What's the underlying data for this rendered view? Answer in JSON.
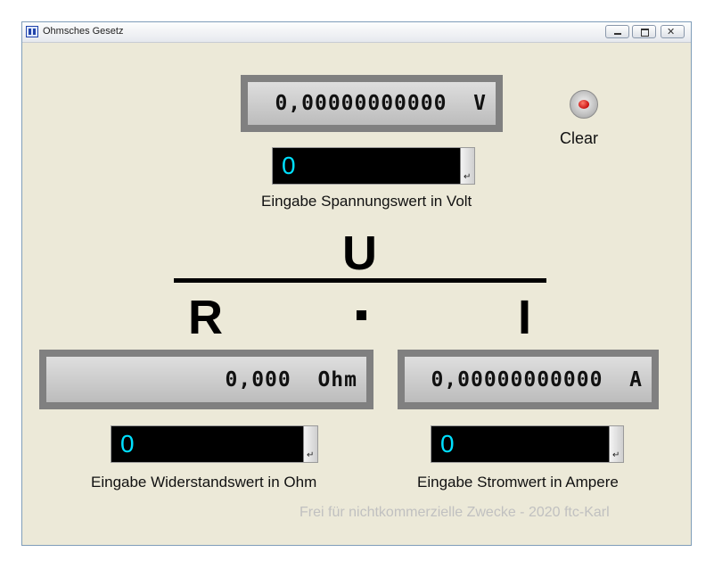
{
  "window": {
    "title": "Ohmsches Gesetz",
    "minimize_glyph": "",
    "close_glyph": "✕"
  },
  "voltage": {
    "display": "0,00000000000  V",
    "input_value": "0",
    "label": "Eingabe Spannungswert in Volt"
  },
  "resistance": {
    "display": "0,000  Ohm",
    "input_value": "0",
    "label": "Eingabe Widerstandswert in Ohm"
  },
  "current": {
    "display": "0,00000000000  A",
    "input_value": "0",
    "label": "Eingabe Stromwert in Ampere"
  },
  "enter_glyph": "↵",
  "clear": {
    "label": "Clear",
    "led_color": "#d01010"
  },
  "formula": {
    "numerator": "U",
    "left": "R",
    "right": "I"
  },
  "footer": "Frei für nichtkommerzielle Zwecke - 2020 ftc-Karl",
  "colors": {
    "background": "#ece9d8",
    "input_text": "#00e0ff",
    "display_frame": "#808080"
  },
  "icons": {
    "app": "app-icon",
    "minimize": "minimize-icon",
    "maximize": "maximize-icon",
    "close": "close-icon",
    "enter": "enter-icon"
  }
}
